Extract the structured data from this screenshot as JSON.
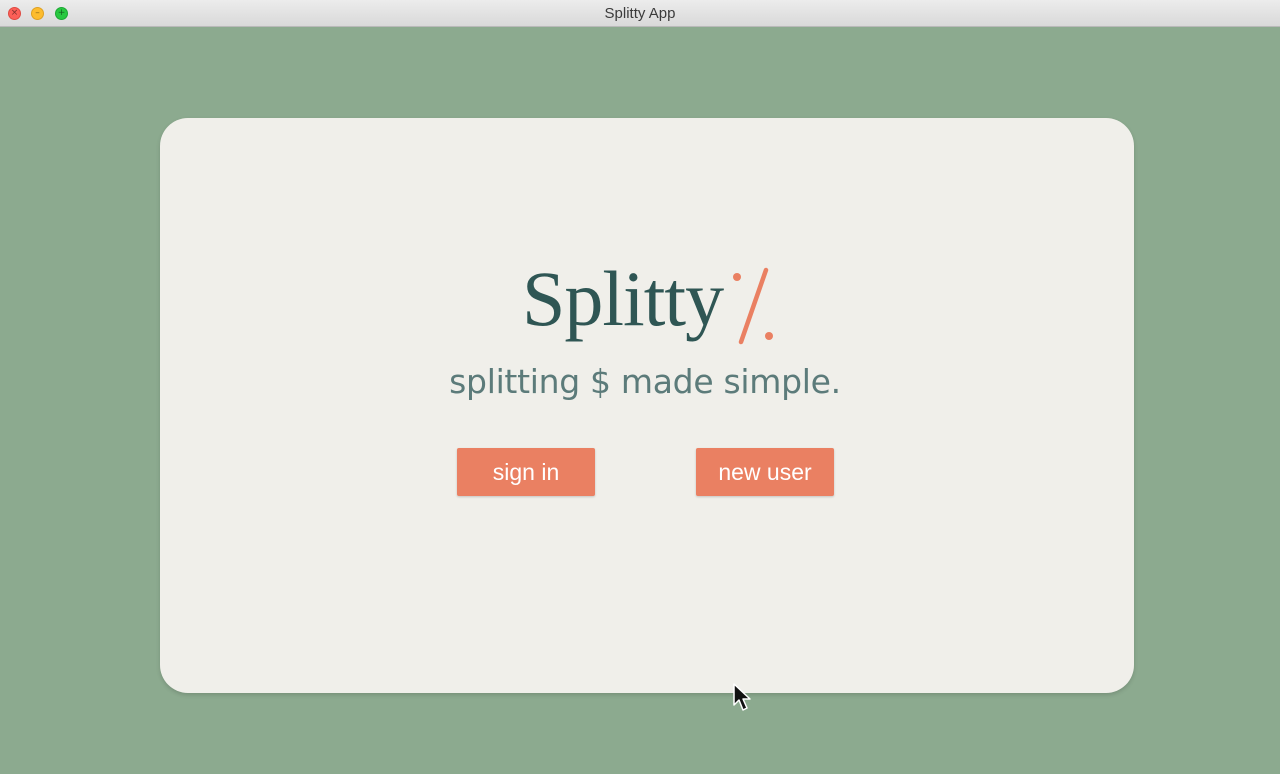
{
  "window": {
    "title": "Splitty App",
    "controls": {
      "close_glyph": "×",
      "minimize_glyph": "–",
      "maximize_glyph": "+"
    }
  },
  "brand": {
    "name": "Splitty",
    "tagline": "splitting $ made simple.",
    "logo_mark_icon": "percent-slash-icon"
  },
  "actions": {
    "sign_in_label": "sign in",
    "new_user_label": "new user"
  },
  "colors": {
    "background": "#8caa8f",
    "card": "#f0efea",
    "brand_text": "#2f5654",
    "accent": "#ea8062",
    "tagline": "#5c7b7a"
  }
}
